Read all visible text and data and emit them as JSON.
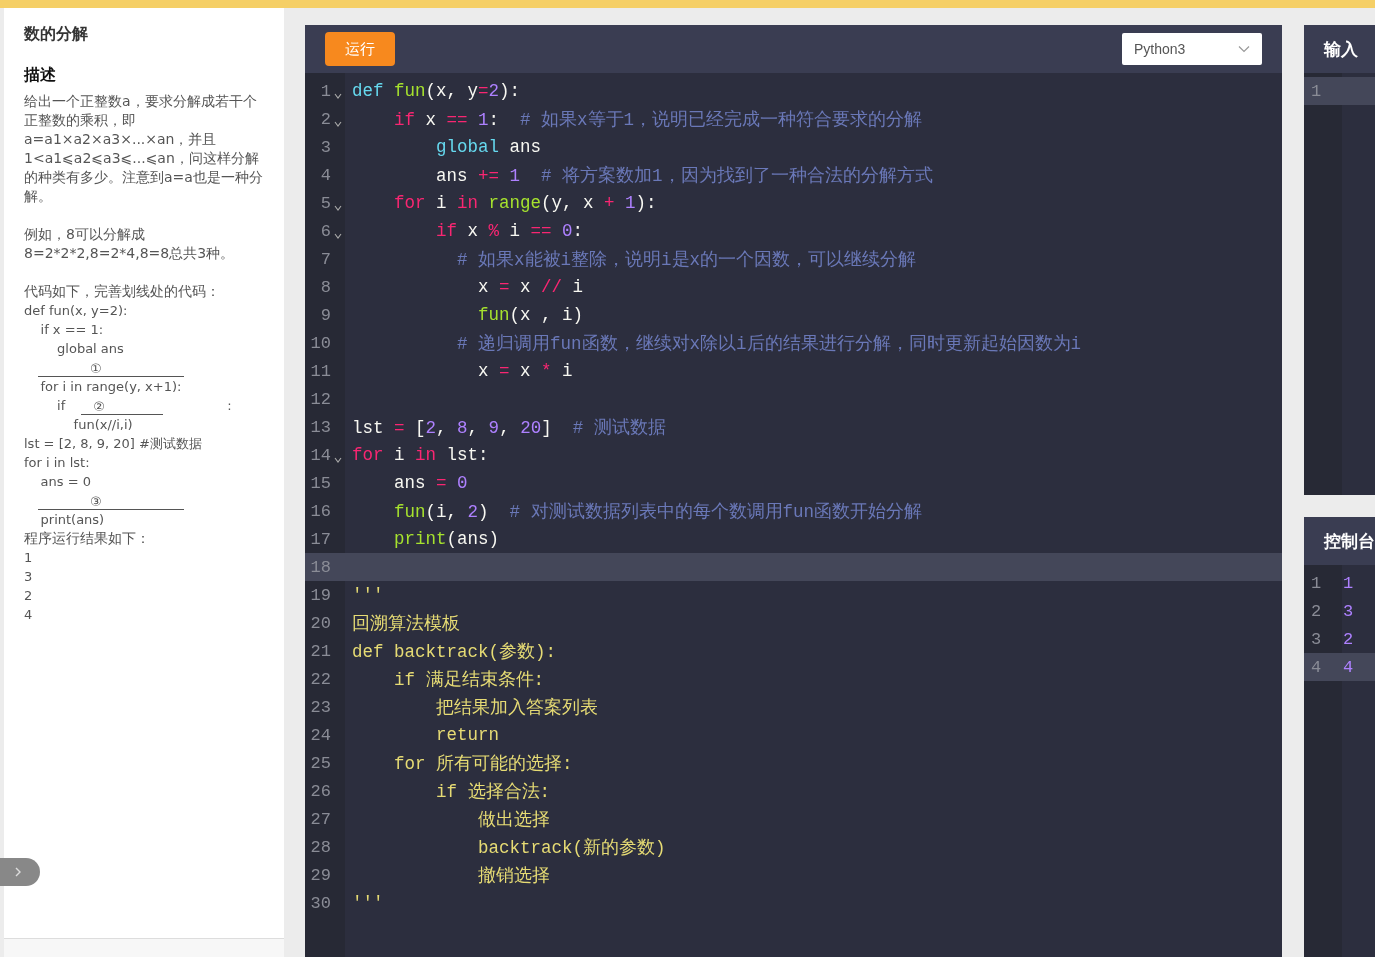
{
  "problem": {
    "title": "数的分解",
    "heading": "描述",
    "lines": [
      {
        "kind": "text",
        "t": "给出一个正整数a，要求分解成若干个正整数的乘积，即a=a1×a2×a3×...×an，并且1<a1⩽a2⩽a3⩽...⩽an，问这样分解的种类有多少。注意到a=a也是一种分解。"
      },
      {
        "kind": "gap"
      },
      {
        "kind": "text",
        "t": "例如，8可以分解成8=2*2*2,8=2*4,8=8总共3种。"
      },
      {
        "kind": "gap"
      },
      {
        "kind": "text",
        "t": "代码如下，完善划线处的代码："
      },
      {
        "kind": "code",
        "t": "def fun(x, y=2):"
      },
      {
        "kind": "code",
        "t": "    if x == 1:"
      },
      {
        "kind": "code",
        "t": "        global ans"
      },
      {
        "kind": "blank",
        "mark": "①"
      },
      {
        "kind": "code",
        "t": "    for i in range(y, x+1):"
      },
      {
        "kind": "blank",
        "pre": "        if",
        "mark": "②",
        "post": ":"
      },
      {
        "kind": "code",
        "t": "            fun(x//i,i)"
      },
      {
        "kind": "code",
        "t": "lst = [2, 8, 9, 20] #测试数据"
      },
      {
        "kind": "code",
        "t": "for i in lst:"
      },
      {
        "kind": "code",
        "t": "    ans = 0"
      },
      {
        "kind": "blank",
        "mark": "③"
      },
      {
        "kind": "code",
        "t": "    print(ans)"
      },
      {
        "kind": "text",
        "t": "程序运行结果如下："
      },
      {
        "kind": "code",
        "t": "1"
      },
      {
        "kind": "code",
        "t": "3"
      },
      {
        "kind": "code",
        "t": "2"
      },
      {
        "kind": "code",
        "t": "4"
      }
    ]
  },
  "toolbar": {
    "run_button": "运行",
    "language": "Python3"
  },
  "editor": {
    "lines": [
      {
        "n": "1",
        "fold": true,
        "selected": false,
        "tokens": [
          {
            "kind": "def",
            "t": "def "
          },
          {
            "kind": "fn",
            "t": "fun"
          },
          {
            "kind": "plain",
            "t": "(x, y"
          },
          {
            "kind": "op",
            "t": "="
          },
          {
            "kind": "num",
            "t": "2"
          },
          {
            "kind": "plain",
            "t": "):"
          }
        ]
      },
      {
        "n": "2",
        "fold": true,
        "selected": false,
        "tokens": [
          {
            "kind": "kw",
            "t": "    if"
          },
          {
            "kind": "plain",
            "t": " x "
          },
          {
            "kind": "op",
            "t": "== "
          },
          {
            "kind": "num",
            "t": "1"
          },
          {
            "kind": "plain",
            "t": ":  "
          },
          {
            "kind": "cm",
            "t": "# 如果x等于1，说明已经完成一种符合要求的分解"
          }
        ]
      },
      {
        "n": "3",
        "fold": false,
        "selected": false,
        "tokens": [
          {
            "kind": "def",
            "t": "        global"
          },
          {
            "kind": "plain",
            "t": " ans"
          }
        ]
      },
      {
        "n": "4",
        "fold": false,
        "selected": false,
        "tokens": [
          {
            "kind": "plain",
            "t": "        ans "
          },
          {
            "kind": "op",
            "t": "+= "
          },
          {
            "kind": "num",
            "t": "1  "
          },
          {
            "kind": "cm",
            "t": "# 将方案数加1，因为找到了一种合法的分解方式"
          }
        ]
      },
      {
        "n": "5",
        "fold": true,
        "selected": false,
        "tokens": [
          {
            "kind": "kw",
            "t": "    for"
          },
          {
            "kind": "plain",
            "t": " i "
          },
          {
            "kind": "kw",
            "t": "in "
          },
          {
            "kind": "fn",
            "t": "range"
          },
          {
            "kind": "plain",
            "t": "(y, x "
          },
          {
            "kind": "op",
            "t": "+ "
          },
          {
            "kind": "num",
            "t": "1"
          },
          {
            "kind": "plain",
            "t": "):"
          }
        ]
      },
      {
        "n": "6",
        "fold": true,
        "selected": false,
        "tokens": [
          {
            "kind": "kw",
            "t": "        if"
          },
          {
            "kind": "plain",
            "t": " x "
          },
          {
            "kind": "op",
            "t": "%"
          },
          {
            "kind": "plain",
            "t": " i "
          },
          {
            "kind": "op",
            "t": "== "
          },
          {
            "kind": "num",
            "t": "0"
          },
          {
            "kind": "plain",
            "t": ":"
          }
        ]
      },
      {
        "n": "7",
        "fold": false,
        "selected": false,
        "tokens": [
          {
            "kind": "cm",
            "t": "          # 如果x能被i整除，说明i是x的一个因数，可以继续分解"
          }
        ]
      },
      {
        "n": "8",
        "fold": false,
        "selected": false,
        "tokens": [
          {
            "kind": "plain",
            "t": "            x "
          },
          {
            "kind": "op",
            "t": "="
          },
          {
            "kind": "plain",
            "t": " x "
          },
          {
            "kind": "op",
            "t": "//"
          },
          {
            "kind": "plain",
            "t": " i"
          }
        ]
      },
      {
        "n": "9",
        "fold": false,
        "selected": false,
        "tokens": [
          {
            "kind": "fn",
            "t": "            fun"
          },
          {
            "kind": "plain",
            "t": "(x , i)"
          }
        ]
      },
      {
        "n": "10",
        "fold": false,
        "selected": false,
        "tokens": [
          {
            "kind": "cm",
            "t": "          # 递归调用fun函数，继续对x除以i后的结果进行分解，同时更新起始因数为i"
          }
        ]
      },
      {
        "n": "11",
        "fold": false,
        "selected": false,
        "tokens": [
          {
            "kind": "plain",
            "t": "            x "
          },
          {
            "kind": "op",
            "t": "="
          },
          {
            "kind": "plain",
            "t": " x "
          },
          {
            "kind": "op",
            "t": "*"
          },
          {
            "kind": "plain",
            "t": " i"
          }
        ]
      },
      {
        "n": "12",
        "fold": false,
        "selected": false
      },
      {
        "n": "13",
        "fold": false,
        "selected": false,
        "tokens": [
          {
            "kind": "plain",
            "t": "lst "
          },
          {
            "kind": "op",
            "t": "="
          },
          {
            "kind": "plain",
            "t": " ["
          },
          {
            "kind": "num",
            "t": "2"
          },
          {
            "kind": "plain",
            "t": ", "
          },
          {
            "kind": "num",
            "t": "8"
          },
          {
            "kind": "plain",
            "t": ", "
          },
          {
            "kind": "num",
            "t": "9"
          },
          {
            "kind": "plain",
            "t": ", "
          },
          {
            "kind": "num",
            "t": "20"
          },
          {
            "kind": "plain",
            "t": "]  "
          },
          {
            "kind": "cm",
            "t": "# 测试数据"
          }
        ]
      },
      {
        "n": "14",
        "fold": true,
        "selected": false,
        "tokens": [
          {
            "kind": "kw",
            "t": "for"
          },
          {
            "kind": "plain",
            "t": " i "
          },
          {
            "kind": "kw",
            "t": "in"
          },
          {
            "kind": "plain",
            "t": " lst:"
          }
        ]
      },
      {
        "n": "15",
        "fold": false,
        "selected": false,
        "tokens": [
          {
            "kind": "plain",
            "t": "    ans "
          },
          {
            "kind": "op",
            "t": "= "
          },
          {
            "kind": "num",
            "t": "0"
          }
        ]
      },
      {
        "n": "16",
        "fold": false,
        "selected": false,
        "tokens": [
          {
            "kind": "fn",
            "t": "    fun"
          },
          {
            "kind": "plain",
            "t": "(i, "
          },
          {
            "kind": "num",
            "t": "2"
          },
          {
            "kind": "plain",
            "t": ")  "
          },
          {
            "kind": "cm",
            "t": "# 对测试数据列表中的每个数调用fun函数开始分解"
          }
        ]
      },
      {
        "n": "17",
        "fold": false,
        "selected": false,
        "tokens": [
          {
            "kind": "fn",
            "t": "    print"
          },
          {
            "kind": "plain",
            "t": "(ans)"
          }
        ]
      },
      {
        "n": "18",
        "fold": false,
        "selected": true
      },
      {
        "n": "19",
        "fold": false,
        "selected": false,
        "tokens": [
          {
            "kind": "doc",
            "t": "'''"
          }
        ]
      },
      {
        "n": "20",
        "fold": false,
        "selected": false,
        "tokens": [
          {
            "kind": "doc",
            "t": "回溯算法模板"
          }
        ]
      },
      {
        "n": "21",
        "fold": false,
        "selected": false,
        "tokens": [
          {
            "kind": "doc",
            "t": "def backtrack(参数):"
          }
        ]
      },
      {
        "n": "22",
        "fold": false,
        "selected": false,
        "tokens": [
          {
            "kind": "doc",
            "t": "    if 满足结束条件:"
          }
        ]
      },
      {
        "n": "23",
        "fold": false,
        "selected": false,
        "tokens": [
          {
            "kind": "doc",
            "t": "        把结果加入答案列表"
          }
        ]
      },
      {
        "n": "24",
        "fold": false,
        "selected": false,
        "tokens": [
          {
            "kind": "doc",
            "t": "        return"
          }
        ]
      },
      {
        "n": "25",
        "fold": false,
        "selected": false,
        "tokens": [
          {
            "kind": "doc",
            "t": "    for 所有可能的选择:"
          }
        ]
      },
      {
        "n": "26",
        "fold": false,
        "selected": false,
        "tokens": [
          {
            "kind": "doc",
            "t": "        if 选择合法:"
          }
        ]
      },
      {
        "n": "27",
        "fold": false,
        "selected": false,
        "tokens": [
          {
            "kind": "doc",
            "t": "            做出选择"
          }
        ]
      },
      {
        "n": "28",
        "fold": false,
        "selected": false,
        "tokens": [
          {
            "kind": "doc",
            "t": "            backtrack(新的参数)"
          }
        ]
      },
      {
        "n": "29",
        "fold": false,
        "selected": false,
        "tokens": [
          {
            "kind": "doc",
            "t": "            撤销选择"
          }
        ]
      },
      {
        "n": "30",
        "fold": false,
        "selected": false,
        "tokens": [
          {
            "kind": "doc",
            "t": "'''"
          }
        ]
      }
    ]
  },
  "input_panel": {
    "title": "输入",
    "lines": [
      {
        "n": "1",
        "selected": true
      }
    ]
  },
  "console": {
    "title": "控制台",
    "lines": [
      {
        "n": "1",
        "value": "1",
        "selected": false
      },
      {
        "n": "2",
        "value": "3",
        "selected": false
      },
      {
        "n": "3",
        "value": "2",
        "selected": false
      },
      {
        "n": "4",
        "value": "4",
        "selected": true
      }
    ]
  }
}
